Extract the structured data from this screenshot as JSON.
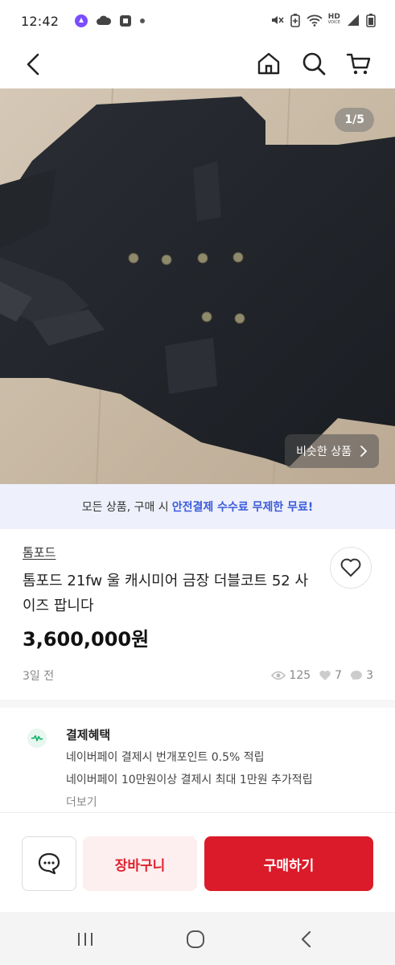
{
  "status_bar": {
    "time": "12:42",
    "hd_label": "HD",
    "voice_label": "VOICE",
    "signal_icons": [
      "mute-icon",
      "battery-saver-icon",
      "wifi-icon",
      "signal-icon",
      "battery-icon"
    ]
  },
  "nav": {
    "back_icon": "chevron-left-icon",
    "home_icon": "home-icon",
    "search_icon": "search-icon",
    "cart_icon": "cart-icon"
  },
  "photo": {
    "counter": "1/5",
    "similar_label": "비슷한 상품"
  },
  "promo": {
    "prefix": "모든 상품, 구매 시",
    "highlight": "안전결제 수수료 무제한 무료!"
  },
  "product": {
    "brand": "톰포드",
    "title": "톰포드 21fw 울 캐시미어 금장 더블코트 52 사이즈 팝니다",
    "price": "3,600,000원",
    "posted": "3일 전",
    "views": "125",
    "likes": "7",
    "chats": "3"
  },
  "benefit": {
    "title": "결제혜택",
    "lines": [
      "네이버페이 결제시 번개포인트 0.5% 적립",
      "네이버페이 10만원이상 결제시 최대 1만원 추가적립"
    ],
    "more": "더보기"
  },
  "actions": {
    "cart_label": "장바구니",
    "buy_label": "구매하기"
  },
  "colors": {
    "accent": "#db1b2a",
    "promo_bg": "#eef0fb",
    "promo_highlight": "#3b5bdb"
  }
}
